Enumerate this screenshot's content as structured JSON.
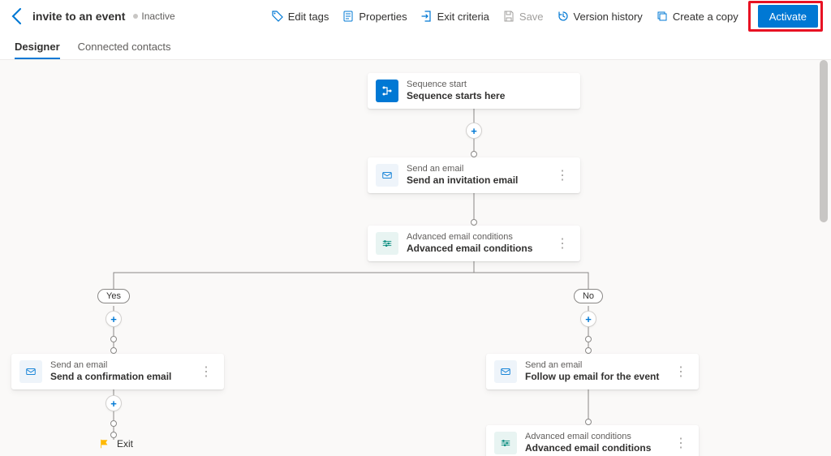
{
  "header": {
    "title": "invite to an event",
    "status": "Inactive",
    "commands": {
      "edit_tags": "Edit tags",
      "properties": "Properties",
      "exit_criteria": "Exit criteria",
      "save": "Save",
      "version_history": "Version history",
      "create_copy": "Create a copy",
      "activate": "Activate"
    }
  },
  "tabs": {
    "designer": "Designer",
    "connected": "Connected contacts"
  },
  "nodes": {
    "start": {
      "type": "Sequence start",
      "name": "Sequence starts here"
    },
    "email1": {
      "type": "Send an email",
      "name": "Send an invitation email"
    },
    "cond1": {
      "type": "Advanced email conditions",
      "name": "Advanced email conditions"
    },
    "yes": "Yes",
    "no": "No",
    "email_yes": {
      "type": "Send an email",
      "name": "Send a confirmation email"
    },
    "email_no": {
      "type": "Send an email",
      "name": "Follow up email for the event"
    },
    "cond_no": {
      "type": "Advanced email conditions",
      "name": "Advanced email conditions"
    },
    "exit": "Exit"
  }
}
